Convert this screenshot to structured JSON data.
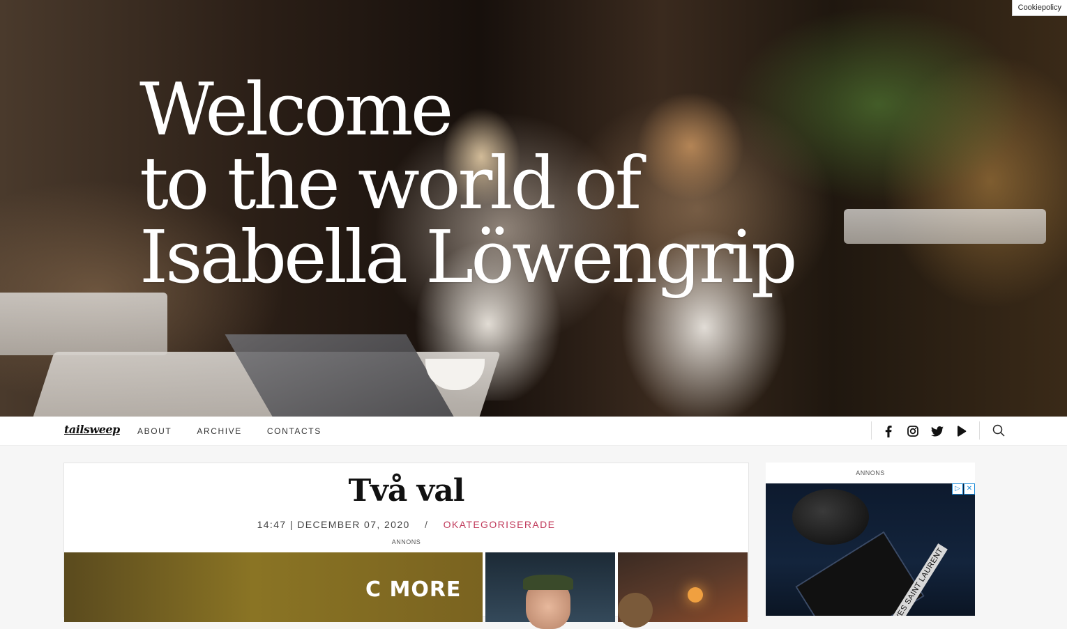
{
  "hero": {
    "title_lines": [
      "Welcome",
      "to the world of",
      "Isabella Löwengrip"
    ]
  },
  "cookie_button": "Cookiepolicy",
  "nav": {
    "logo": "tailsweep",
    "links": [
      "ABOUT",
      "ARCHIVE",
      "CONTACTS"
    ],
    "social_icons": [
      "facebook-icon",
      "instagram-icon",
      "twitter-icon",
      "youtube-play-icon"
    ],
    "search_icon": "search-icon"
  },
  "post": {
    "title": "Två val",
    "meta_datetime": "14:47 | DECEMBER 07, 2020",
    "meta_separator": "/",
    "meta_category": "OKATEGORISERADE",
    "annons_label": "ANNONS",
    "ad_logo": "C MORE"
  },
  "sidebar": {
    "annons_label": "ANNONS",
    "ad_brand": "YVES SAINT LAURENT",
    "ad_choices": [
      "▷",
      "✕"
    ]
  },
  "colors": {
    "category_accent": "#c0395a",
    "page_bg": "#f6f6f6"
  }
}
